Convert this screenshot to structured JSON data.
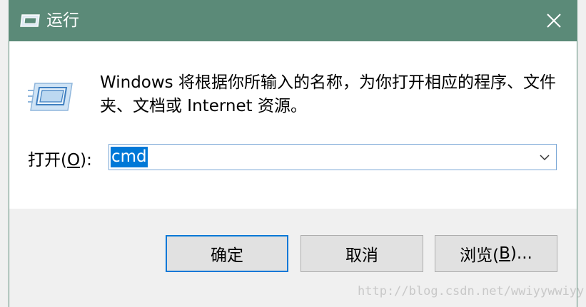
{
  "window": {
    "title": "运行",
    "title_icon": "run-app-icon",
    "close_icon": "close-icon",
    "colors": {
      "titlebar": "#5b8a78",
      "selection": "#0078d7",
      "default_button_border": "#0078d7"
    }
  },
  "content": {
    "description": "Windows 将根据你所输入的名称，为你打开相应的程序、文件夹、文档或 Internet 资源。",
    "run_icon": "run-dialog-icon"
  },
  "open_field": {
    "label_prefix": "打开(",
    "label_hotkey": "O",
    "label_suffix": "):",
    "value": "cmd",
    "dropdown_icon": "chevron-down-icon"
  },
  "buttons": {
    "ok": "确定",
    "cancel": "取消",
    "browse_prefix": "浏览(",
    "browse_hotkey": "B",
    "browse_suffix": ")..."
  },
  "watermark": "http://blog.csdn.net/wwiyywwiyy"
}
